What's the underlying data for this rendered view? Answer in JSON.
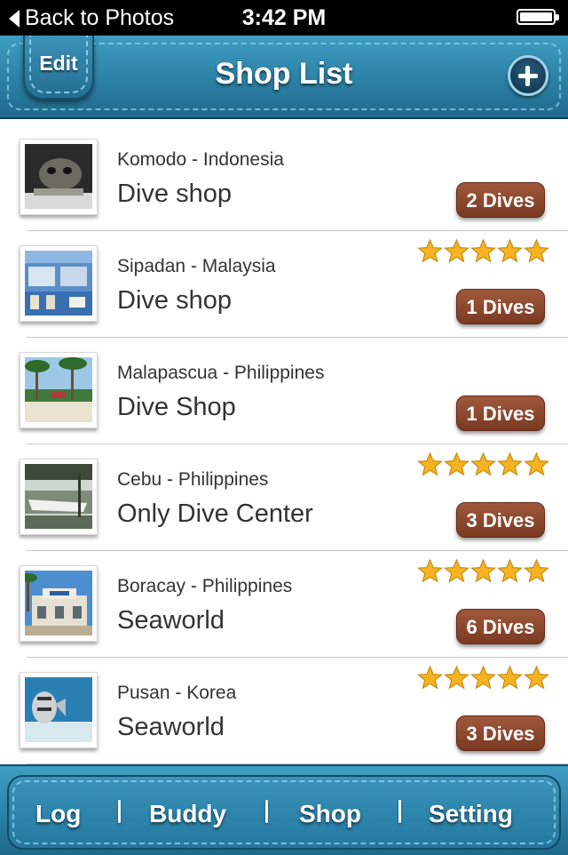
{
  "status_bar": {
    "back_label": "Back to Photos",
    "time": "3:42 PM"
  },
  "header": {
    "edit_label": "Edit",
    "title": "Shop List"
  },
  "shops": [
    {
      "location": "Komodo - Indonesia",
      "name": "Dive shop",
      "dives": "2 Dives",
      "rating": 0,
      "photo": "moray-eel"
    },
    {
      "location": "Sipadan - Malaysia",
      "name": "Dive shop",
      "dives": "1 Dives",
      "rating": 5,
      "photo": "shop-interior"
    },
    {
      "location": "Malapascua - Philippines",
      "name": "Dive Shop",
      "dives": "1 Dives",
      "rating": 0,
      "photo": "palm-beach"
    },
    {
      "location": "Cebu - Philippines",
      "name": "Only Dive Center",
      "dives": "3 Dives",
      "rating": 5,
      "photo": "boat-dock"
    },
    {
      "location": "Boracay - Philippines",
      "name": "Seaworld",
      "dives": "6 Dives",
      "rating": 5,
      "photo": "seaworld-building"
    },
    {
      "location": "Pusan - Korea",
      "name": "Seaworld",
      "dives": "3 Dives",
      "rating": 5,
      "photo": "batfish-underwater"
    }
  ],
  "tabs": [
    {
      "label": "Log"
    },
    {
      "label": "Buddy"
    },
    {
      "label": "Shop"
    },
    {
      "label": "Setting"
    }
  ],
  "colors": {
    "header_blue": "#2a7ea3",
    "dives_badge": "#8b4529",
    "star": "#f5b321"
  }
}
